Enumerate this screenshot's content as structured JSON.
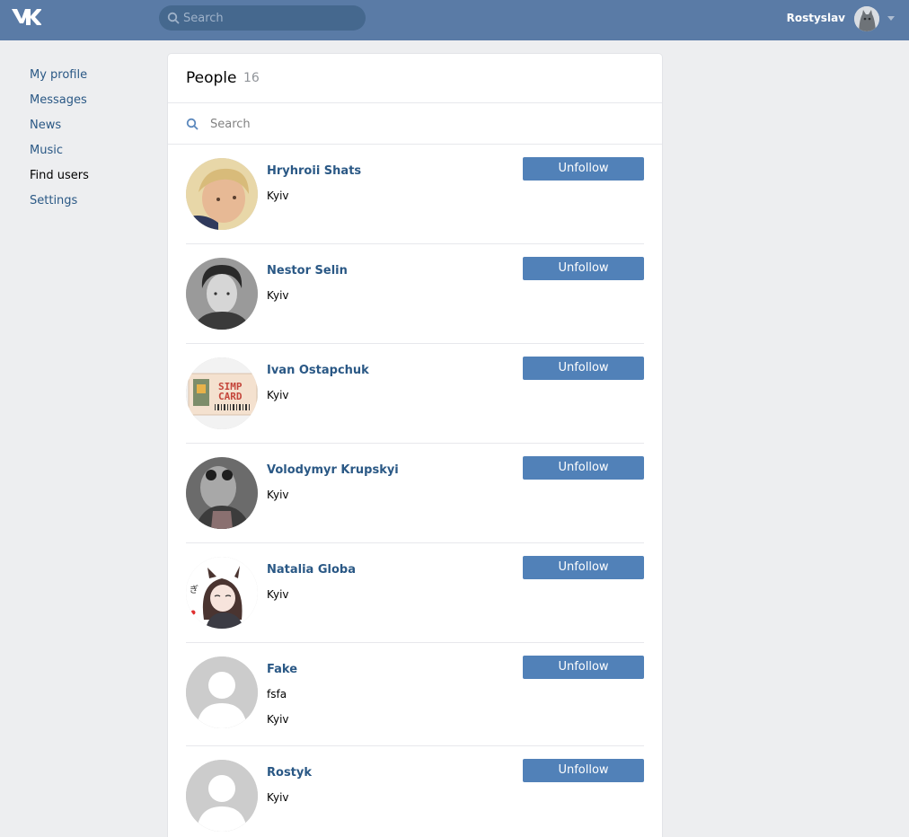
{
  "topbar": {
    "search_placeholder": "Search",
    "user_name": "Rostyslav"
  },
  "sidebar": {
    "items": [
      {
        "label": "My profile"
      },
      {
        "label": "Messages"
      },
      {
        "label": "News"
      },
      {
        "label": "Music"
      },
      {
        "label": "Find users",
        "active": true
      },
      {
        "label": "Settings"
      }
    ]
  },
  "main": {
    "title": "People",
    "count": "16",
    "search_placeholder": "Search",
    "people": [
      {
        "name": "Hryhroii Shats",
        "line1": "Kyiv",
        "line2": "",
        "button": "Unfollow",
        "avatar": "photo-boy"
      },
      {
        "name": "Nestor Selin",
        "line1": "Kyiv",
        "line2": "",
        "button": "Unfollow",
        "avatar": "photo-bw-man"
      },
      {
        "name": "Ivan Ostapchuk",
        "line1": "Kyiv",
        "line2": "",
        "button": "Unfollow",
        "avatar": "simp-card"
      },
      {
        "name": "Volodymyr Krupskyi",
        "line1": "Kyiv",
        "line2": "",
        "button": "Unfollow",
        "avatar": "photo-masked-man"
      },
      {
        "name": "Natalia Globa",
        "line1": "Kyiv",
        "line2": "",
        "button": "Unfollow",
        "avatar": "anime-girl"
      },
      {
        "name": "Fake",
        "line1": "fsfa",
        "line2": "Kyiv",
        "button": "Unfollow",
        "avatar": "default-avatar"
      },
      {
        "name": "Rostyk",
        "line1": "Kyiv",
        "line2": "",
        "button": "Unfollow",
        "avatar": "default-avatar"
      }
    ]
  },
  "colors": {
    "header_bg": "#5a7ba6",
    "page_bg": "#edeef0",
    "link": "#2a5885",
    "button_bg": "#5181b8"
  }
}
